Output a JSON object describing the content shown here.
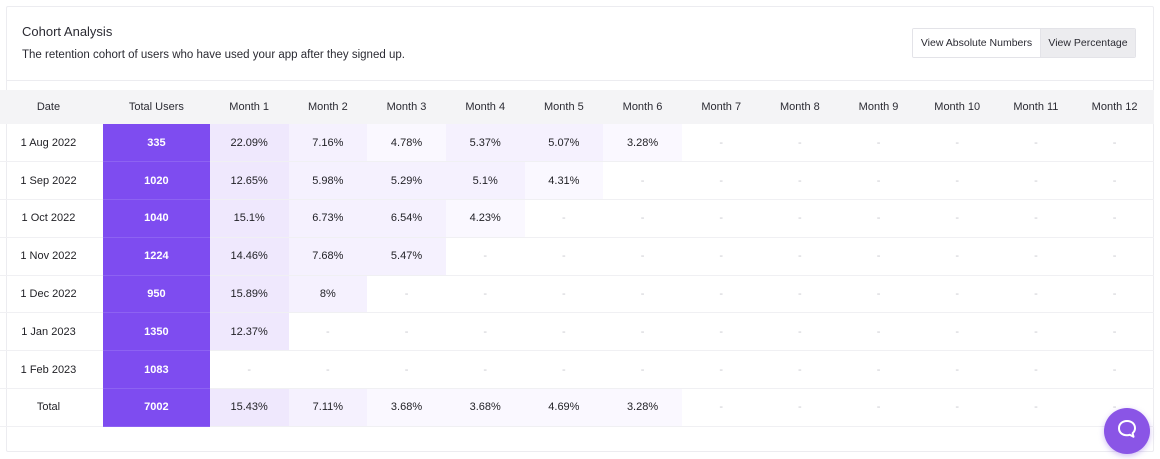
{
  "header": {
    "title": "Cohort Analysis",
    "subtitle": "The retention cohort of users who have used your app after they signed up."
  },
  "toggle": {
    "absolute_label": "View Absolute Numbers",
    "percentage_label": "View Percentage",
    "selected": "percentage"
  },
  "table": {
    "columns": [
      "Date",
      "Total Users",
      "Month 1",
      "Month 2",
      "Month 3",
      "Month 4",
      "Month 5",
      "Month 6",
      "Month 7",
      "Month 8",
      "Month 9",
      "Month 10",
      "Month 11",
      "Month 12"
    ],
    "empty_marker": "-",
    "rows": [
      {
        "date": "1 Aug 2022",
        "total": "335",
        "months": [
          "22.09%",
          "7.16%",
          "4.78%",
          "5.37%",
          "5.07%",
          "3.28%",
          "-",
          "-",
          "-",
          "-",
          "-",
          "-"
        ]
      },
      {
        "date": "1 Sep 2022",
        "total": "1020",
        "months": [
          "12.65%",
          "5.98%",
          "5.29%",
          "5.1%",
          "4.31%",
          "-",
          "-",
          "-",
          "-",
          "-",
          "-",
          "-"
        ]
      },
      {
        "date": "1 Oct 2022",
        "total": "1040",
        "months": [
          "15.1%",
          "6.73%",
          "6.54%",
          "4.23%",
          "-",
          "-",
          "-",
          "-",
          "-",
          "-",
          "-",
          "-"
        ]
      },
      {
        "date": "1 Nov 2022",
        "total": "1224",
        "months": [
          "14.46%",
          "7.68%",
          "5.47%",
          "-",
          "-",
          "-",
          "-",
          "-",
          "-",
          "-",
          "-",
          "-"
        ]
      },
      {
        "date": "1 Dec 2022",
        "total": "950",
        "months": [
          "15.89%",
          "8%",
          "-",
          "-",
          "-",
          "-",
          "-",
          "-",
          "-",
          "-",
          "-",
          "-"
        ]
      },
      {
        "date": "1 Jan 2023",
        "total": "1350",
        "months": [
          "12.37%",
          "-",
          "-",
          "-",
          "-",
          "-",
          "-",
          "-",
          "-",
          "-",
          "-",
          "-"
        ]
      },
      {
        "date": "1 Feb 2023",
        "total": "1083",
        "months": [
          "-",
          "-",
          "-",
          "-",
          "-",
          "-",
          "-",
          "-",
          "-",
          "-",
          "-",
          "-"
        ]
      },
      {
        "date": "Total",
        "total": "7002",
        "months": [
          "15.43%",
          "7.11%",
          "3.68%",
          "3.68%",
          "4.69%",
          "3.28%",
          "-",
          "-",
          "-",
          "-",
          "-",
          "-"
        ]
      }
    ]
  },
  "colors": {
    "accent": "#7e4cf0",
    "chat_button": "#8a55e6"
  },
  "icons": {
    "chat": "chat-bubble-icon"
  }
}
